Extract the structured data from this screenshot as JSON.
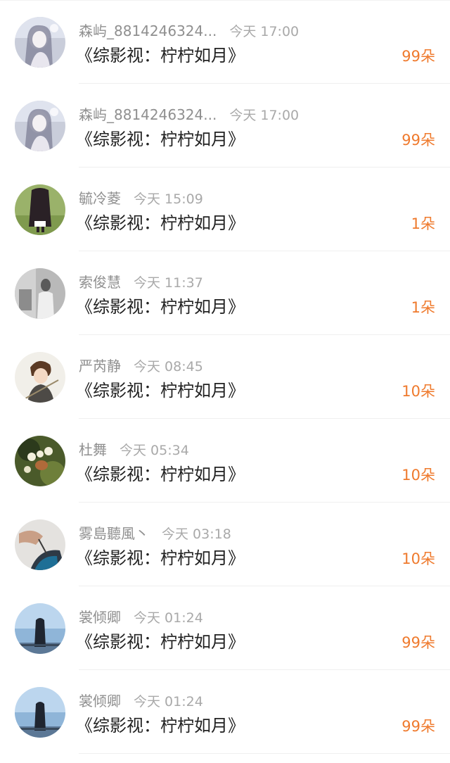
{
  "colors": {
    "accent": "#ef7a2d",
    "title": "#222222",
    "name": "#8f8f8f",
    "time": "#a9a9a9"
  },
  "items": [
    {
      "name": "森屿_8814246324...",
      "time": "今天 17:00",
      "title": "《综影视：柠柠如月》",
      "amount": "99朵",
      "avatar": "girl-sketch-avatar"
    },
    {
      "name": "森屿_8814246324...",
      "time": "今天 17:00",
      "title": "《综影视：柠柠如月》",
      "amount": "99朵",
      "avatar": "girl-sketch-avatar"
    },
    {
      "name": "毓冷菱",
      "time": "今天 15:09",
      "title": "《综影视：柠柠如月》",
      "amount": "1朵",
      "avatar": "long-hair-girl-avatar"
    },
    {
      "name": "索俊慧",
      "time": "今天 11:37",
      "title": "《综影视：柠柠如月》",
      "amount": "1朵",
      "avatar": "grayscale-photo-avatar"
    },
    {
      "name": "严芮静",
      "time": "今天 08:45",
      "title": "《综影视：柠柠如月》",
      "amount": "10朵",
      "avatar": "anime-boy-avatar"
    },
    {
      "name": "杜舞",
      "time": "今天 05:34",
      "title": "《综影视：柠柠如月》",
      "amount": "10朵",
      "avatar": "flower-avatar"
    },
    {
      "name": "雾島聽風丶",
      "time": "今天 03:18",
      "title": "《综影视：柠柠如月》",
      "amount": "10朵",
      "avatar": "hand-umbrella-avatar"
    },
    {
      "name": "裳倾卿",
      "time": "今天 01:24",
      "title": "《综影视：柠柠如月》",
      "amount": "99朵",
      "avatar": "seaside-girl-avatar"
    },
    {
      "name": "裳倾卿",
      "time": "今天 01:24",
      "title": "《综影视：柠柠如月》",
      "amount": "99朵",
      "avatar": "seaside-girl-avatar"
    }
  ]
}
